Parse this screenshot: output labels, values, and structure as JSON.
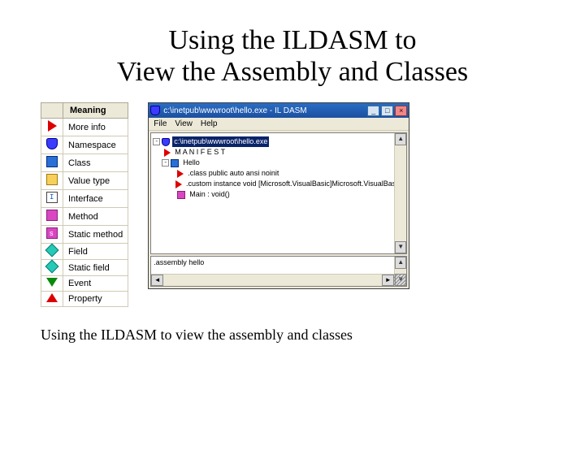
{
  "title_line1": "Using the ILDASM to",
  "title_line2": "View the Assembly and Classes",
  "caption": "Using the ILDASM to view the assembly and classes",
  "legend": {
    "header_icon": "",
    "header_meaning": "Meaning",
    "rows": [
      {
        "label": "More info"
      },
      {
        "label": "Namespace"
      },
      {
        "label": "Class"
      },
      {
        "label": "Value type"
      },
      {
        "label": "Interface"
      },
      {
        "label": "Method"
      },
      {
        "label": "Static method"
      },
      {
        "label": "Field"
      },
      {
        "label": "Static field"
      },
      {
        "label": "Event"
      },
      {
        "label": "Property"
      }
    ]
  },
  "window": {
    "title": "c:\\inetpub\\wwwroot\\hello.exe - IL DASM",
    "minbtn": "_",
    "maxbtn": "□",
    "closebtn": "×",
    "menu": {
      "file": "File",
      "view": "View",
      "help": "Help"
    },
    "tree": {
      "root": "c:\\inetpub\\wwwroot\\hello.exe",
      "manifest": "M A N I F E S T",
      "hello": "Hello",
      "hello_item1": ".class public auto ansi noinit",
      "hello_item2": ".custom instance void [Microsoft.VisualBasic]Microsoft.VisualBasic.",
      "hello_item3": "Main : void()"
    },
    "bottom": {
      "line": ".assembly hello"
    },
    "scroll_up": "▲",
    "scroll_down": "▼",
    "scroll_left": "◄",
    "scroll_right": "►"
  }
}
